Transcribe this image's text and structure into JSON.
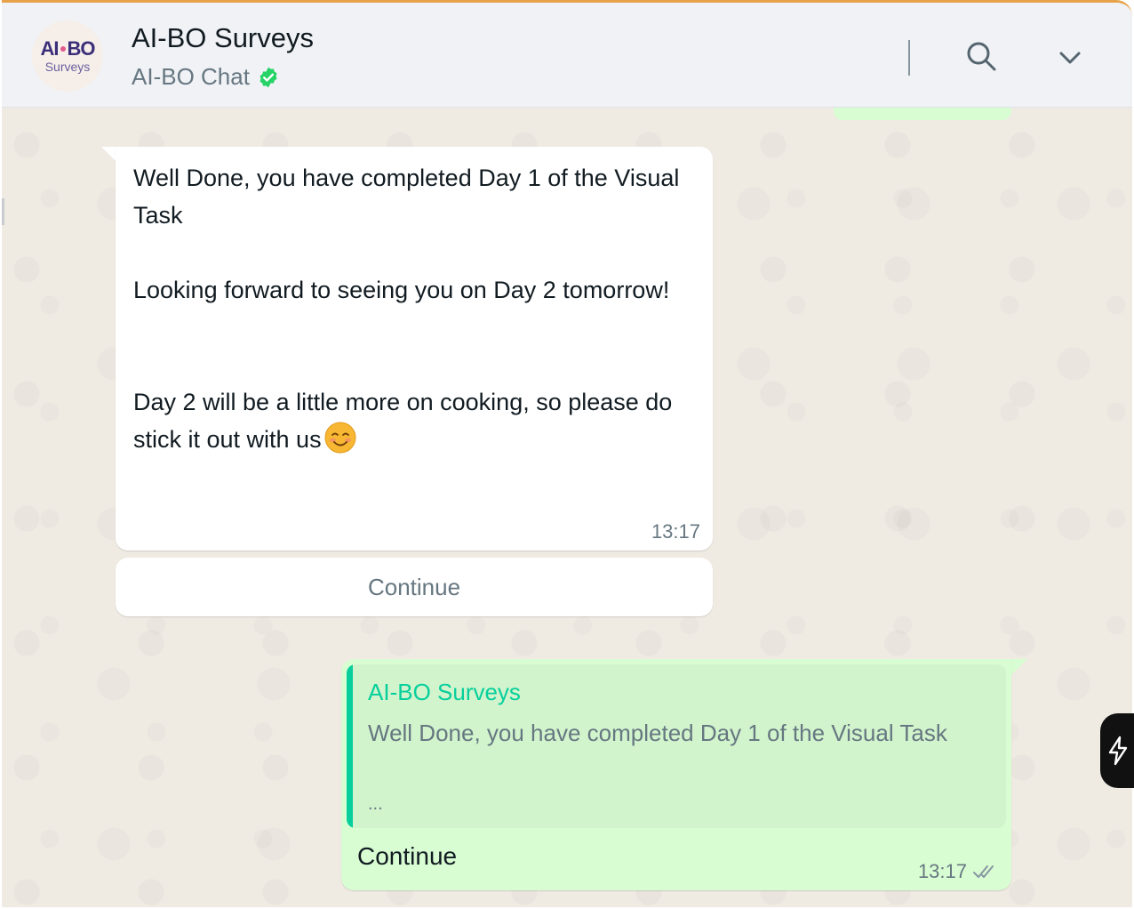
{
  "header": {
    "avatar_logo_top_left": "AI",
    "avatar_logo_top_right": "BO",
    "avatar_logo_bottom": "Surveys",
    "title": "AI-BO Surveys",
    "subtitle": "AI-BO Chat",
    "icons": [
      "verified-badge-icon",
      "search-icon",
      "chevron-down-icon"
    ],
    "colors": {
      "verified": "#25d366"
    }
  },
  "incoming_message": {
    "paragraph_1": "Well Done, you have completed Day 1 of the Visual Task",
    "paragraph_2": "Looking forward to seeing you on Day 2 tomorrow!",
    "paragraph_3": "Day 2 will be a little more on cooking, so please do stick it out with us",
    "emoji": "smiling-face-emoji",
    "time": "13:17",
    "button_label": "Continue"
  },
  "outgoing_message": {
    "quote_author": "AI-BO Surveys",
    "quote_text": "Well Done, you have completed Day 1 of the Visual Task",
    "quote_ellipsis": "...",
    "text": "Continue",
    "time": "13:17",
    "status_icon": "double-check-icon"
  },
  "side_tab": {
    "icon": "lightning-icon"
  },
  "colors": {
    "chat_background": "#efeae2",
    "outgoing_bubble": "#d9fdd3",
    "quote_accent": "#06cf9c",
    "header_background": "#f0f2f5"
  }
}
